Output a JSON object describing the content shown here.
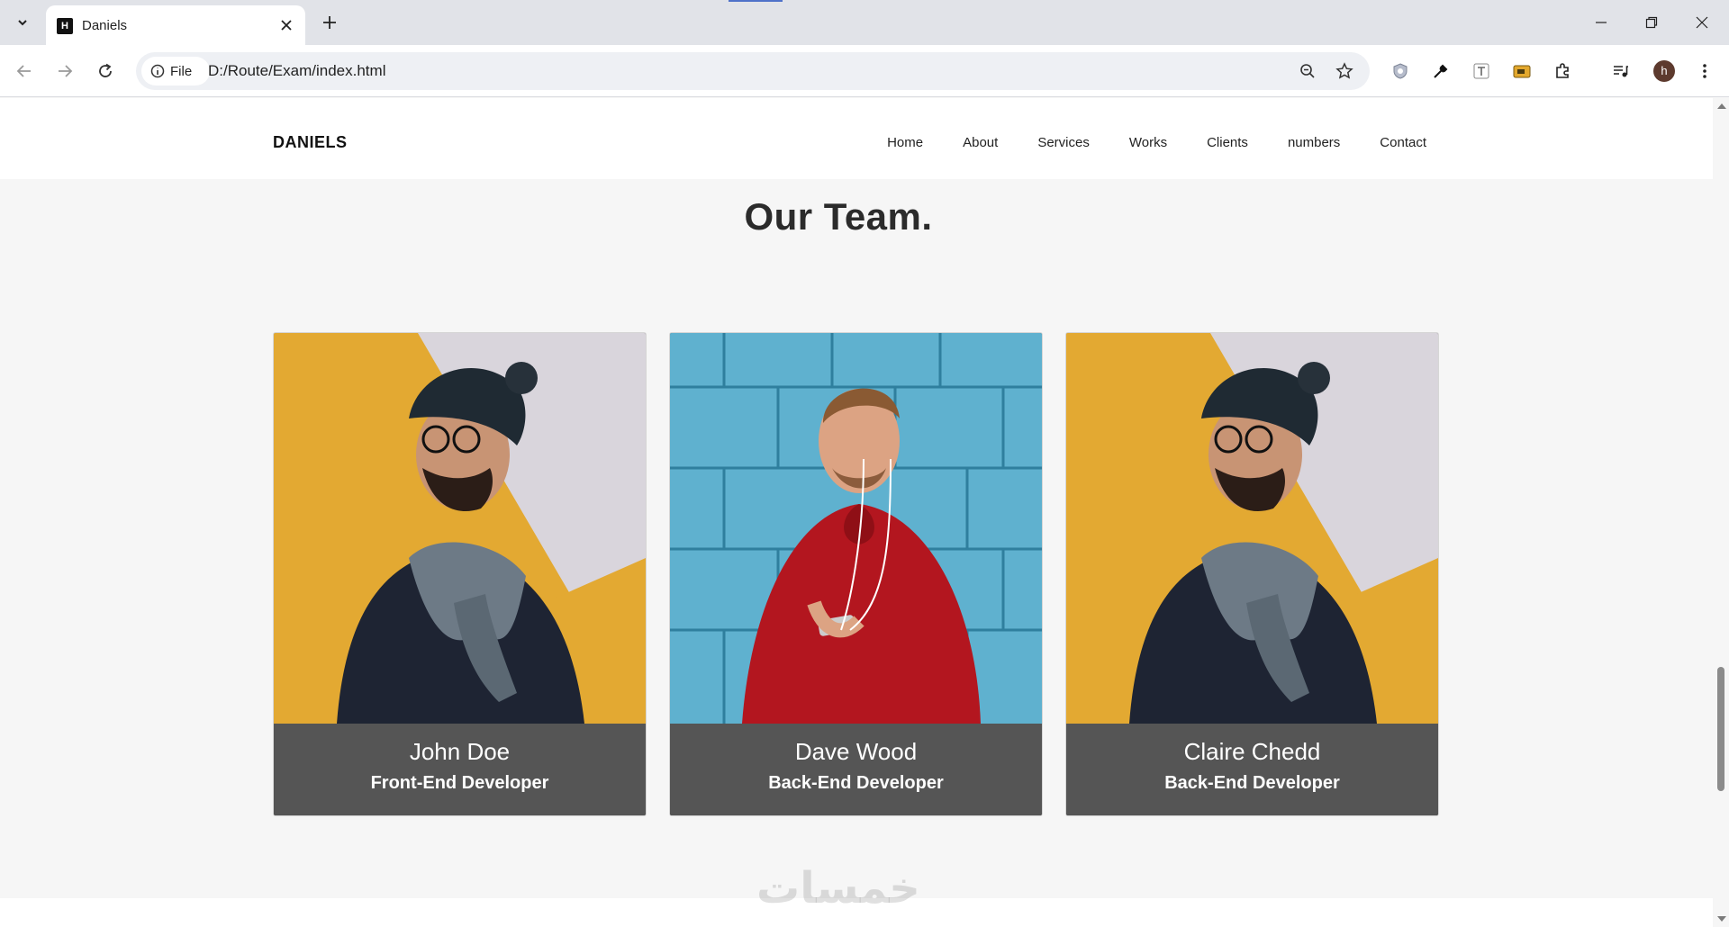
{
  "browser": {
    "tab_title": "Daniels",
    "favicon_letter": "H",
    "site_chip_label": "File",
    "url": "D:/Route/Exam/index.html",
    "avatar_letter": "h"
  },
  "site": {
    "brand": "DANIELS",
    "menu": [
      "Home",
      "About",
      "Services",
      "Works",
      "Clients",
      "numbers",
      "Contact"
    ]
  },
  "team": {
    "title": "Our Team.",
    "members": [
      {
        "name": "John Doe",
        "role": "Front-End Developer"
      },
      {
        "name": "Dave Wood",
        "role": "Back-End Developer"
      },
      {
        "name": "Claire Chedd",
        "role": "Back-End Developer"
      }
    ]
  },
  "watermark": "خمسات",
  "colors": {
    "card_footer": "#555555",
    "page_bg": "#f6f6f6",
    "accent_loading": "#4f72c9"
  }
}
